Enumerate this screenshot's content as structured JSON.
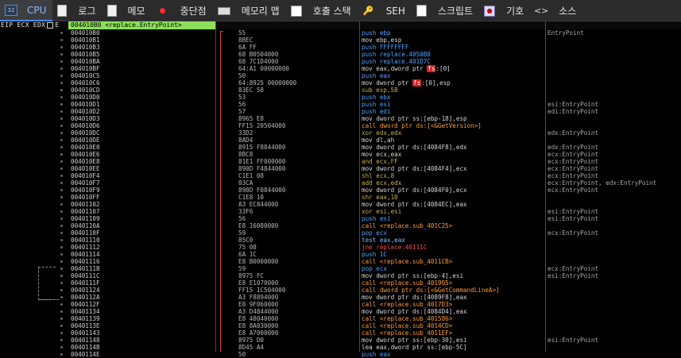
{
  "tabs": [
    {
      "name": "tab-cpu",
      "icon": "cpu-icon",
      "label": "CPU"
    },
    {
      "name": "tab-log",
      "icon": "log-icon",
      "label": "로그"
    },
    {
      "name": "tab-notes",
      "icon": "notes-icon",
      "label": "메모"
    },
    {
      "name": "tab-breakpoints",
      "icon": "breakpoint-icon",
      "label": "중단점"
    },
    {
      "name": "tab-memory-map",
      "icon": "memory-map-icon",
      "label": "메모리 맵"
    },
    {
      "name": "tab-call-stack",
      "icon": "call-stack-icon",
      "label": "호출 스택"
    },
    {
      "name": "tab-seh",
      "icon": "seh-icon",
      "label": "SEH"
    },
    {
      "name": "tab-script",
      "icon": "script-icon",
      "label": "스크립트"
    },
    {
      "name": "tab-symbols",
      "icon": "symbols-icon",
      "label": "기호"
    },
    {
      "name": "tab-source",
      "icon": "source-icon",
      "label": "소스"
    }
  ],
  "header": {
    "regs": "EIP ECX EDX",
    "reg_marker": "E",
    "current": "004010B0 <replace.EntryPoint>"
  },
  "rows": [
    {
      "addr": "004010B0",
      "bytes": "55",
      "instr": "push ebp",
      "cmt": "EntryPoint"
    },
    {
      "addr": "004010B1",
      "bytes": "8BEC",
      "instr": "mov ebp,esp",
      "cmt": ""
    },
    {
      "addr": "004010B3",
      "bytes": "6A FF",
      "instr": "push FFFFFFFF",
      "cmt": ""
    },
    {
      "addr": "004010B5",
      "bytes": "68 B0504000",
      "instr": "push replace.4050B0",
      "cmt": ""
    },
    {
      "addr": "004010BA",
      "bytes": "68 7C1D4000",
      "instr": "push replace.401D7C",
      "cmt": ""
    },
    {
      "addr": "004010BF",
      "bytes": "64:A1 00000000",
      "instr": "mov eax,dword ptr [fs]:[0]",
      "cmt": ""
    },
    {
      "addr": "004010C5",
      "bytes": "50",
      "instr": "push eax",
      "cmt": ""
    },
    {
      "addr": "004010C6",
      "bytes": "64:8925 00000000",
      "instr": "mov dword ptr [fs]:[0],esp",
      "cmt": ""
    },
    {
      "addr": "004010CD",
      "bytes": "83EC 58",
      "instr": "sub esp,58",
      "cmt": ""
    },
    {
      "addr": "004010D0",
      "bytes": "53",
      "instr": "push ebx",
      "cmt": ""
    },
    {
      "addr": "004010D1",
      "bytes": "56",
      "instr": "push esi",
      "cmt": "esi:EntryPoint"
    },
    {
      "addr": "004010D2",
      "bytes": "57",
      "instr": "push edi",
      "cmt": "edi:EntryPoint"
    },
    {
      "addr": "004010D3",
      "bytes": "8965 E8",
      "instr": "mov dword ptr ss:[ebp-18],esp",
      "cmt": ""
    },
    {
      "addr": "004010D6",
      "bytes": "FF15 20504000",
      "instr": "call dword ptr ds:[<&GetVersion>]",
      "cmt": ""
    },
    {
      "addr": "004010DC",
      "bytes": "33D2",
      "instr": "xor edx,edx",
      "cmt": "edx:EntryPoint"
    },
    {
      "addr": "004010DE",
      "bytes": "8AD4",
      "instr": "mov dl,ah",
      "cmt": ""
    },
    {
      "addr": "004010E0",
      "bytes": "8915 F8844000",
      "instr": "mov dword ptr ds:[4084F8],edx",
      "cmt": "edx:EntryPoint"
    },
    {
      "addr": "004010E6",
      "bytes": "8BC8",
      "instr": "mov ecx,eax",
      "cmt": "ecx:EntryPoint"
    },
    {
      "addr": "004010E8",
      "bytes": "81E1 FF000000",
      "instr": "and ecx,FF",
      "cmt": "ecx:EntryPoint"
    },
    {
      "addr": "004010EE",
      "bytes": "890D F4844000",
      "instr": "mov dword ptr ds:[4084F4],ecx",
      "cmt": "ecx:EntryPoint"
    },
    {
      "addr": "004010F4",
      "bytes": "C1E1 08",
      "instr": "shl ecx,8",
      "cmt": "ecx:EntryPoint"
    },
    {
      "addr": "004010F7",
      "bytes": "03CA",
      "instr": "add ecx,edx",
      "cmt": "ecx:EntryPoint, edx:EntryPoint"
    },
    {
      "addr": "004010F9",
      "bytes": "890D F0844000",
      "instr": "mov dword ptr ds:[4084F0],ecx",
      "cmt": "ecx:EntryPoint"
    },
    {
      "addr": "004010FF",
      "bytes": "C1E8 10",
      "instr": "shr eax,10",
      "cmt": ""
    },
    {
      "addr": "00401102",
      "bytes": "A3 EC844000",
      "instr": "mov dword ptr ds:[4084EC],eax",
      "cmt": ""
    },
    {
      "addr": "00401107",
      "bytes": "33F6",
      "instr": "xor esi,esi",
      "cmt": "esi:EntryPoint"
    },
    {
      "addr": "00401109",
      "bytes": "56",
      "instr": "push esi",
      "cmt": "esi:EntryPoint"
    },
    {
      "addr": "0040110A",
      "bytes": "E8 16080000",
      "instr": "call <replace.sub_401C25>",
      "cmt": ""
    },
    {
      "addr": "0040110F",
      "bytes": "59",
      "instr": "pop ecx",
      "cmt": "ecx:EntryPoint"
    },
    {
      "addr": "00401110",
      "bytes": "85C0",
      "instr": "test eax,eax",
      "cmt": ""
    },
    {
      "addr": "00401112",
      "bytes": "75 08",
      "instr": "jne replace.40111C",
      "cmt": ""
    },
    {
      "addr": "00401114",
      "bytes": "6A 1C",
      "instr": "push 1C",
      "cmt": ""
    },
    {
      "addr": "00401116",
      "bytes": "E8 B0000000",
      "instr": "call <replace.sub_4011CB>",
      "cmt": ""
    },
    {
      "addr": "0040111B",
      "bytes": "59",
      "instr": "pop ecx",
      "cmt": "ecx:EntryPoint"
    },
    {
      "addr": "0040111C",
      "bytes": "8975 FC",
      "instr": "mov dword ptr ss:[ebp-4],esi",
      "cmt": "esi:EntryPoint"
    },
    {
      "addr": "0040111F",
      "bytes": "E8 E1070000",
      "instr": "call <replace.sub_401905>",
      "cmt": ""
    },
    {
      "addr": "00401124",
      "bytes": "FF15 1C504000",
      "instr": "call dword ptr ds:[<&GetCommandLineA>]",
      "cmt": ""
    },
    {
      "addr": "0040112A",
      "bytes": "A3 F8894000",
      "instr": "mov dword ptr ds:[4089F8],eax",
      "cmt": ""
    },
    {
      "addr": "0040112F",
      "bytes": "E8 9F060000",
      "instr": "call <replace.sub_4017D3>",
      "cmt": ""
    },
    {
      "addr": "00401134",
      "bytes": "A3 D4844000",
      "instr": "mov dword ptr ds:[4084D4],eax",
      "cmt": ""
    },
    {
      "addr": "00401139",
      "bytes": "E8 48040000",
      "instr": "call <replace.sub_401586>",
      "cmt": ""
    },
    {
      "addr": "0040113E",
      "bytes": "E8 8A030000",
      "instr": "call <replace.sub_4014CD>",
      "cmt": ""
    },
    {
      "addr": "00401143",
      "bytes": "E8 A7000000",
      "instr": "call <replace.sub_4011EF>",
      "cmt": ""
    },
    {
      "addr": "00401148",
      "bytes": "8975 D0",
      "instr": "mov dword ptr ss:[ebp-30],esi",
      "cmt": "esi:EntryPoint"
    },
    {
      "addr": "0040114B",
      "bytes": "8D45 A4",
      "instr": "lea eax,dword ptr ss:[ebp-5C]",
      "cmt": ""
    },
    {
      "addr": "0040114E",
      "bytes": "50",
      "instr": "push eax",
      "cmt": ""
    }
  ],
  "colors": {
    "push": "#4fa3ff",
    "call": "#ff9b3a",
    "jump": "#ff4848",
    "mov": "#d8d8d8",
    "arith": "#c7b34a",
    "test": "#7fbfff",
    "pop": "#4fa3ff",
    "xor": "#c7b34a",
    "lea": "#d8d8d8"
  }
}
